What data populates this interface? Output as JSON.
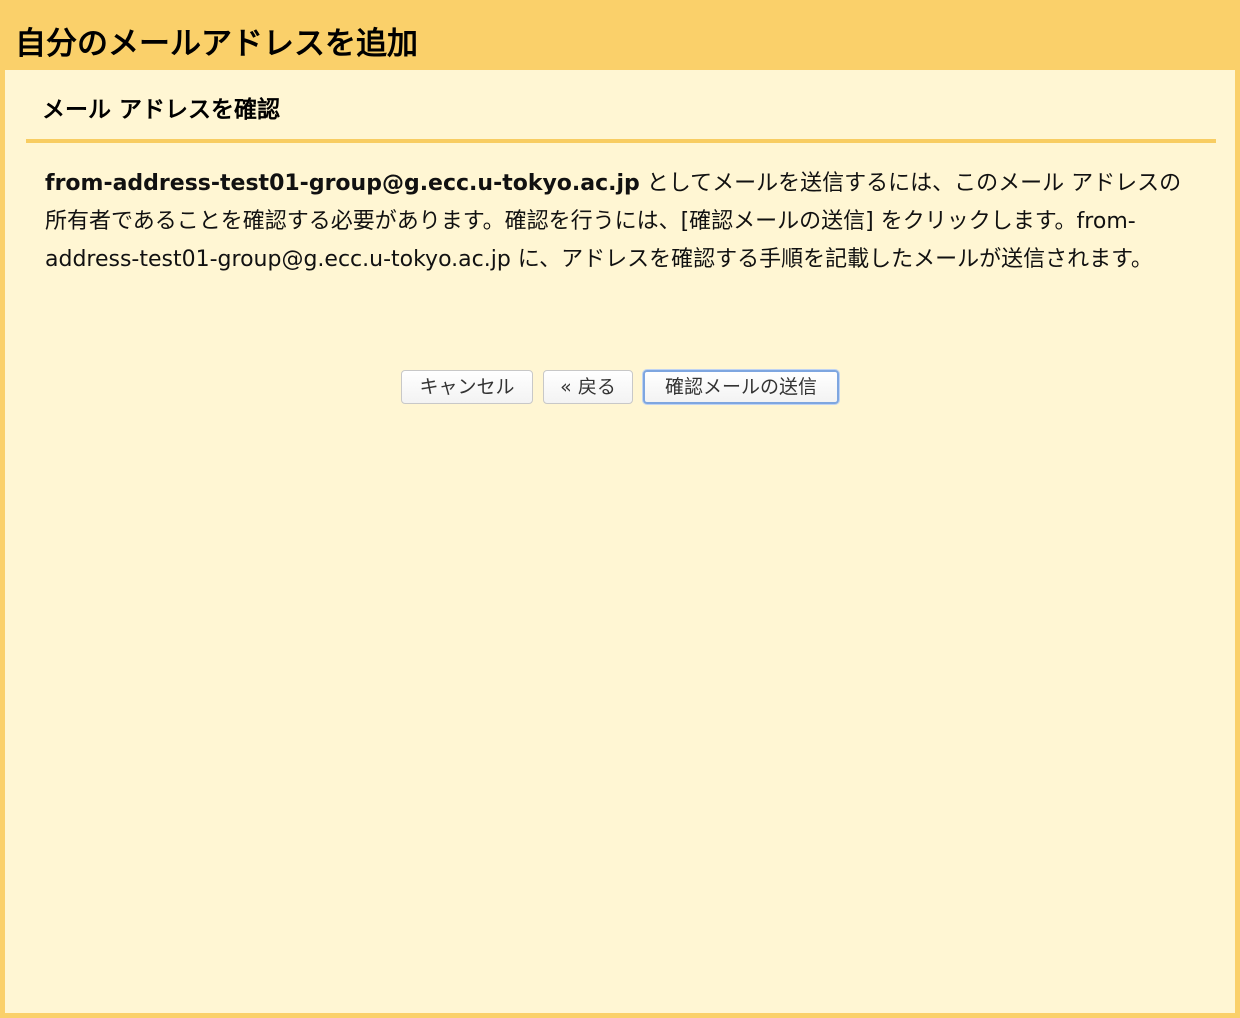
{
  "window": {
    "title": "自分のメールアドレスを追加"
  },
  "section": {
    "heading": "メール アドレスを確認"
  },
  "message": {
    "email_bold": "from-address-test01-group@g.ecc.u-tokyo.ac.jp",
    "text_part1": " としてメールを送信するには、このメール アドレスの所有者であることを確認する必要があります。確認を行うには、[確認メールの送信] をクリックします。",
    "email_plain": "from-address-test01-group@g.ecc.u-tokyo.ac.jp",
    "text_part2": " に、アドレスを確認する手順を記載したメールが送信されます。"
  },
  "buttons": {
    "cancel_label": "キャンセル",
    "back_label": "« 戻る",
    "send_label": "確認メールの送信"
  },
  "colors": {
    "title_bar": "#fad06a",
    "panel_bg": "#fff6d3",
    "rule": "#f8cd62",
    "primary_border": "#7ea6e0"
  }
}
